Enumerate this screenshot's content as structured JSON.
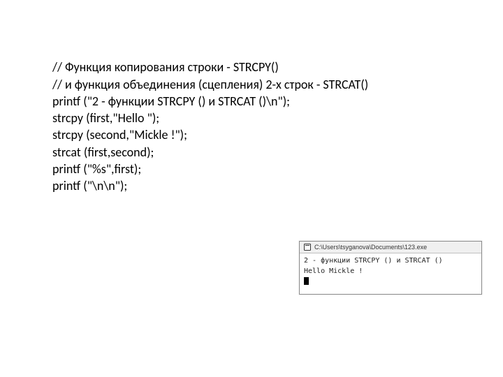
{
  "code": {
    "lines": [
      "// Функция копирования строки - STRCPY()",
      "// и функция объединения (сцепления) 2-х строк - STRCAT()",
      "printf (\"2 - функции STRCPY () и STRCAT ()\\n\");",
      "strcpy (first,\"Hello \");",
      "strcpy (second,\"Mickle !\");",
      "strcat (first,second);",
      "printf (\"%s\",first);",
      "printf (\"\\n\\n\");"
    ]
  },
  "console": {
    "title": "C:\\Users\\tsyganova\\Documents\\123.exe",
    "output_line1": "2 - функции STRCPY () и STRCAT ()",
    "output_line2": "Hello Mickle !"
  }
}
